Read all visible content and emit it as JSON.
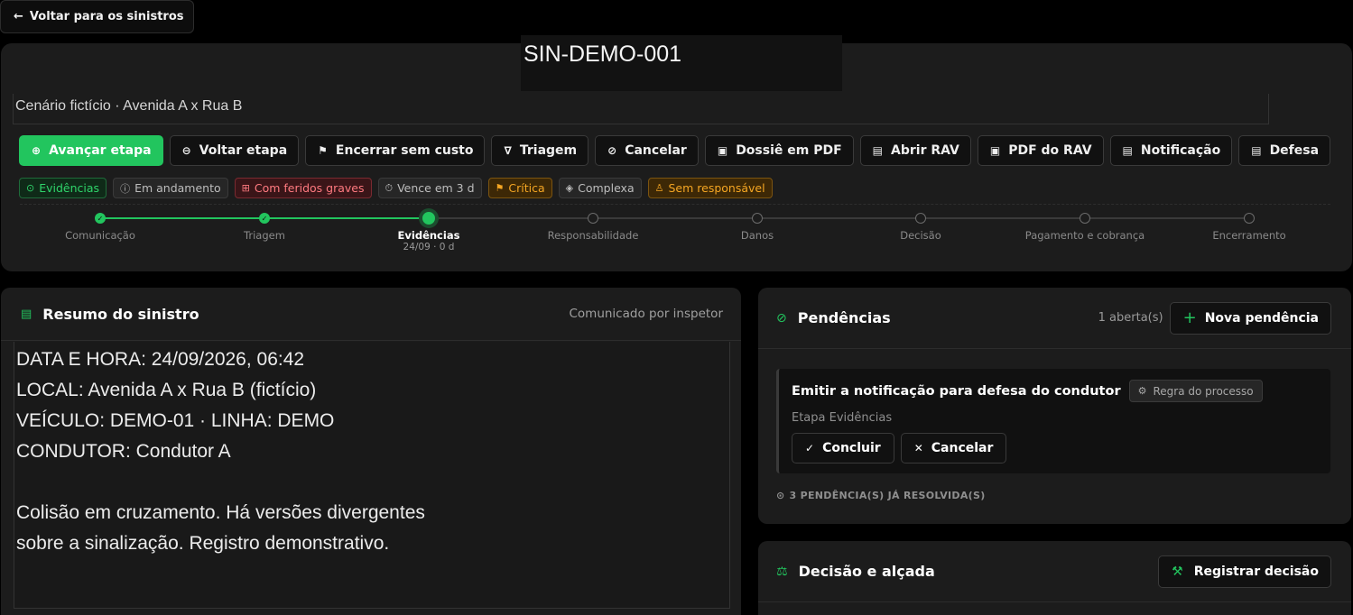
{
  "back": {
    "label": "Voltar para os sinistros"
  },
  "header": {
    "id": "SIN-DEMO-001",
    "scenario": "Cenário fictício · Avenida A x Rua B"
  },
  "actions": [
    {
      "label": "Avançar etapa",
      "icon": "arrow-circle-icon"
    },
    {
      "label": "Voltar etapa",
      "icon": "back-circle-icon"
    },
    {
      "label": "Encerrar sem custo",
      "icon": "flag-icon"
    },
    {
      "label": "Triagem",
      "icon": "filter-icon"
    },
    {
      "label": "Cancelar",
      "icon": "ban-icon"
    },
    {
      "label": "Dossiê em PDF",
      "icon": "pdf-icon"
    },
    {
      "label": "Abrir RAV",
      "icon": "document-icon"
    },
    {
      "label": "PDF do RAV",
      "icon": "pdf-icon"
    },
    {
      "label": "Notificação",
      "icon": "document-icon"
    },
    {
      "label": "Defesa",
      "icon": "document-icon"
    }
  ],
  "badges": [
    {
      "label": "Evidências",
      "style": "green"
    },
    {
      "label": "Em andamento",
      "style": "neutral"
    },
    {
      "label": "Com feridos graves",
      "style": "red"
    },
    {
      "label": "Vence em 3 d",
      "style": "neutral"
    },
    {
      "label": "Crítica",
      "style": "orange"
    },
    {
      "label": "Complexa",
      "style": "neutral"
    },
    {
      "label": "Sem responsável",
      "style": "orange"
    }
  ],
  "steps": [
    {
      "label": "Comunicação",
      "state": "done"
    },
    {
      "label": "Triagem",
      "state": "done"
    },
    {
      "label": "Evidências",
      "state": "current",
      "sub": "24/09 · 0 d"
    },
    {
      "label": "Responsabilidade",
      "state": "pending"
    },
    {
      "label": "Danos",
      "state": "pending"
    },
    {
      "label": "Decisão",
      "state": "pending"
    },
    {
      "label": "Pagamento e cobrança",
      "state": "pending"
    },
    {
      "label": "Encerramento",
      "state": "pending"
    }
  ],
  "summary": {
    "title": "Resumo do sinistro",
    "meta": "Comunicado por inspetor",
    "text": "DATA E HORA: 24/09/2026, 06:42\nLOCAL: Avenida A x Rua B (fictício)\nVEÍCULO: DEMO-01 · LINHA: DEMO\nCONDUTOR: Condutor A\n\nColisão em cruzamento. Há versões divergentes\nsobre a sinalização. Registro demonstrativo."
  },
  "pendencias": {
    "title": "Pendências",
    "count": "1 aberta(s)",
    "new_label": "Nova pendência",
    "task": {
      "title": "Emitir a notificação para defesa do condutor",
      "rule": "Regra do processo",
      "stage": "Etapa Evidências",
      "conclude": "Concluir",
      "cancel": "Cancelar"
    },
    "resolved": "3 PENDÊNCIA(S) JÁ RESOLVIDA(S)"
  },
  "decisao": {
    "title": "Decisão e alçada",
    "register": "Registrar decisão"
  },
  "colors": {
    "accent": "#22c55e",
    "background": "#000000",
    "card": "#1c1c1c"
  }
}
